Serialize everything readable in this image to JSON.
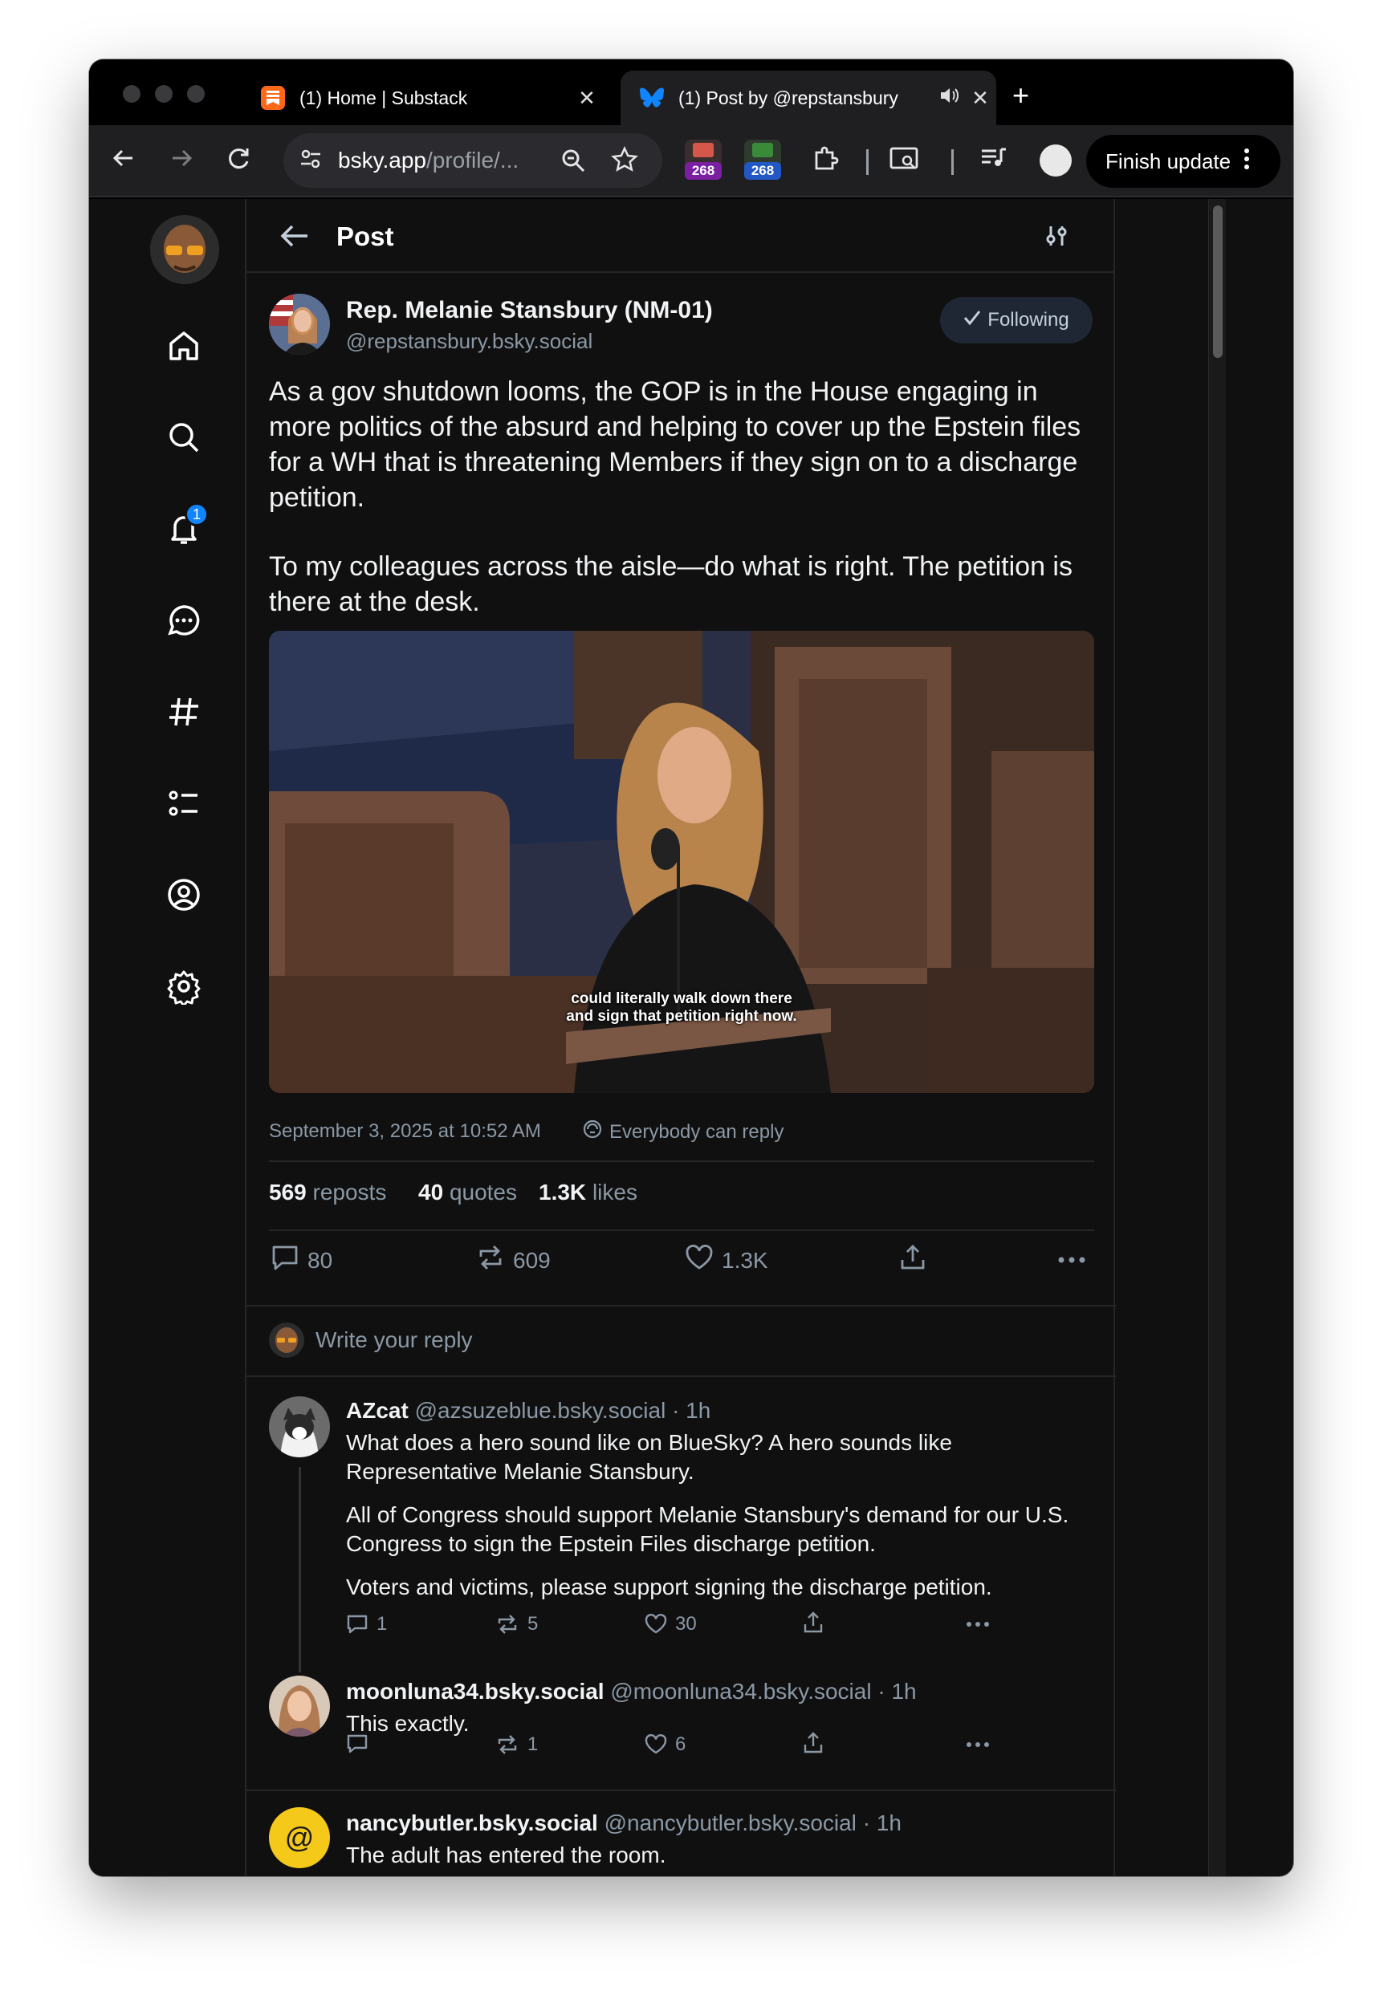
{
  "browser": {
    "tabs": [
      {
        "title": "(1) Home | Substack",
        "close": "✕"
      },
      {
        "title": "(1) Post by @repstansbury",
        "close": "✕"
      }
    ],
    "new_tab": "+",
    "url_main": "bsky.app",
    "url_rest": "/profile/...",
    "ext_badge_1": "268",
    "ext_badge_2": "268",
    "finish_update": "Finish update",
    "accent_colors": {
      "substack": "#ff6719",
      "bluesky": "#1185fe"
    }
  },
  "nav": {
    "notification_count": "1",
    "items": [
      "home-icon",
      "search-icon",
      "notifications-icon",
      "chat-icon",
      "feeds-icon",
      "lists-icon",
      "profile-icon",
      "settings-icon"
    ]
  },
  "header": {
    "title": "Post"
  },
  "post": {
    "author_name": "Rep. Melanie Stansbury (NM-01)",
    "author_handle": "@repstansbury.bsky.social",
    "following_label": "Following",
    "text_p1": "As a gov shutdown looms, the GOP is in the House engaging in more politics of the absurd and helping to cover up the Epstein files for a WH that is threatening Members if they sign on to a discharge petition.",
    "text_p2": "To my colleagues across the aisle—do what is right. The petition is there at the desk.",
    "video_caption_1": "could literally walk down there",
    "video_caption_2": "and sign that petition right now.",
    "timestamp": "September 3, 2025 at 10:52 AM",
    "reply_setting": "Everybody can reply",
    "stats": {
      "reposts_count": "569",
      "reposts_label": "reposts",
      "quotes_count": "40",
      "quotes_label": "quotes",
      "likes_count": "1.3K",
      "likes_label": "likes"
    },
    "actions": {
      "replies": "80",
      "reposts": "609",
      "likes": "1.3K"
    }
  },
  "reply_box": {
    "placeholder": "Write your reply"
  },
  "replies": [
    {
      "name": "AZcat",
      "handle": "@azsuzeblue.bsky.social",
      "time": "· 1h",
      "lines": [
        "What does a hero sound like on BlueSky?  A hero sounds like Representative Melanie Stansbury.",
        "All of Congress should support Melanie Stansbury's demand for our U.S. Congress to sign the Epstein Files discharge petition.",
        "Voters and victims, please support signing the discharge petition."
      ],
      "replies": "1",
      "reposts": "5",
      "likes": "30"
    },
    {
      "name": "moonluna34.bsky.social",
      "handle": "@moonluna34.bsky.social",
      "time": "· 1h",
      "lines": [
        "This exactly."
      ],
      "replies": "",
      "reposts": "1",
      "likes": "6"
    },
    {
      "name": "nancybutler.bsky.social",
      "handle": "@nancybutler.bsky.social",
      "time": "· 1h",
      "lines": [
        "The adult has entered the room."
      ],
      "avatar_glyph": "@"
    }
  ]
}
